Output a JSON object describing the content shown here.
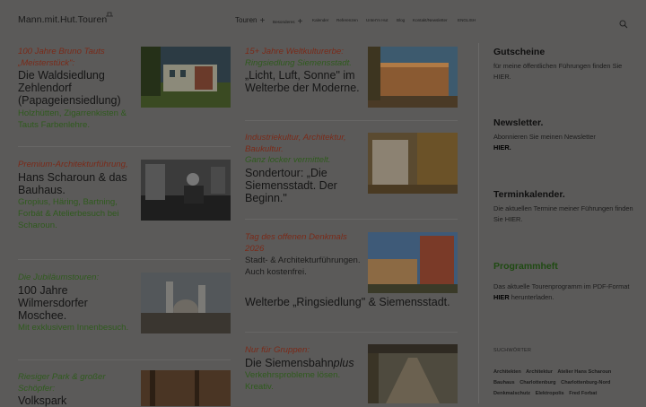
{
  "header": {
    "logo": "Mann.mit.Hut.Touren",
    "nav": [
      {
        "label": "Touren",
        "plus": true
      },
      {
        "label": "Besonderes",
        "plus": true
      },
      {
        "label": "Kalender",
        "plus": false
      },
      {
        "label": "Referenzen",
        "plus": false
      },
      {
        "label": "Unter'm Hut",
        "plus": false
      },
      {
        "label": "Blog",
        "plus": false
      },
      {
        "label": "Kontakt/Newsletter",
        "plus": false
      },
      {
        "label": "ENGLISH",
        "plus": false
      }
    ],
    "search_icon": "search-icon"
  },
  "left_column": [
    {
      "kicker": "100 Jahre Bruno Tauts „Meisterstück\":",
      "title": "Die Waldsiedlung Zehlendorf (Papageiensiedlung)",
      "sub": "Holzhütten, Zigarrenkisten & Tauts Farbenlehre."
    },
    {
      "kicker": "Premium-Architekturführung,",
      "title": "Hans Scharoun & das Bauhaus.",
      "sub": "Gropius, Häring, Bartning, Forbát & Atelierbesuch bei Scharoun."
    },
    {
      "kicker": "Die Jubiläumstouren:",
      "title": "100 Jahre Wilmersdorfer Moschee.",
      "sub": "Mit exklusivem Innenbesuch."
    },
    {
      "kicker": "Riesiger Park & großer Schöpfer:",
      "title": "Volkspark",
      "sub": ""
    }
  ],
  "mid_column": [
    {
      "kicker": "15+ Jahre Weltkulturerbe:",
      "kicker2": "Ringsiedlung Siemensstadt.",
      "title": "„Licht, Luft, Sonne\" im Welterbe der Moderne.",
      "sub": ""
    },
    {
      "kicker": "Industriekultur, Architektur, Baukultur.",
      "kicker2": "Ganz locker vermittelt.",
      "title": "Sondertour: „Die Siemensstadt. Der Beginn.\"",
      "sub": ""
    },
    {
      "kicker": "Tag des offenen Denkmals 2026",
      "kicker2": "",
      "title": "Welterbe „Ringsiedlung\" & Siemensstadt.",
      "sub": "",
      "pre": "Stadt- & Architekturführungen. Auch kostenfrei."
    },
    {
      "kicker": "Nur für Gruppen:",
      "kicker2": "",
      "title": "Die Siemensbahn",
      "title_em": "plus",
      "sub": "Verkehrsprobleme lösen. Kreativ."
    }
  ],
  "sidebar": {
    "gutscheine": {
      "title": "Gutscheine",
      "text": "für meine öffentlichen Führungen finden Sie HIER."
    },
    "newsletter": {
      "title": "Newsletter.",
      "text": "Abonnieren Sie meinen Newsletter",
      "link": "HIER."
    },
    "termine": {
      "title": "Terminkalender.",
      "text": "Die aktuellen Termine meiner Führungen finden Sie HIER."
    },
    "programm": {
      "title": "Programmheft",
      "text": "Das aktuelle Tourenprogramm im PDF-Format",
      "link": "HIER",
      "text2": " herunterladen."
    },
    "tags_title": "SUCHWÖRTER",
    "tags": [
      "Architekten",
      "Architektur",
      "Atelier Hans Scharoun",
      "Bauhaus",
      "Charlottenburg",
      "Charlottenburg-Nord",
      "Denkmalschutz",
      "Elektropolis",
      "Fred Forbat"
    ]
  },
  "colors": {
    "overlay": "#5b5a59",
    "kicker_red": "#7a2a19",
    "green": "#2f5a1d"
  }
}
